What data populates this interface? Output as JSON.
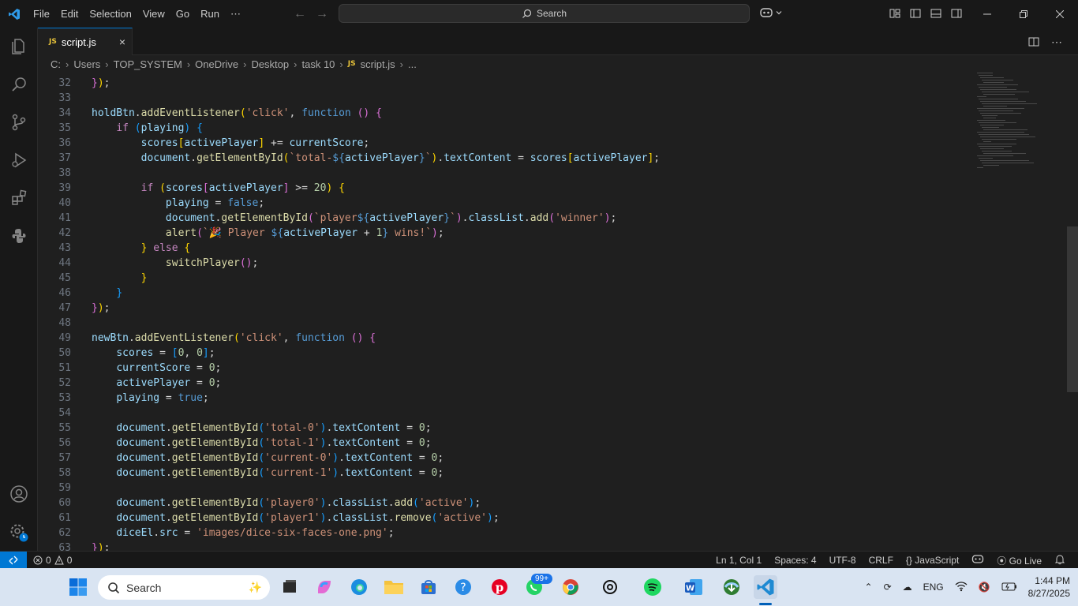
{
  "titlebar": {
    "menu": [
      "File",
      "Edit",
      "Selection",
      "View",
      "Go",
      "Run",
      "⋯"
    ],
    "search_label": "Search",
    "colors": {
      "accent": "#0078d4"
    }
  },
  "tab": {
    "label": "script.js",
    "badge": "JS",
    "close": "×"
  },
  "breadcrumb": {
    "items": [
      "C:",
      "Users",
      "TOP_SYSTEM",
      "OneDrive",
      "Desktop",
      "task 10",
      "script.js",
      "..."
    ]
  },
  "editor": {
    "lines": [
      {
        "n": "32",
        "html": "<span class=\"pb\">}</span><span class=\"p\">)</span><span class=\"t\">;</span>"
      },
      {
        "n": "33",
        "html": ""
      },
      {
        "n": "34",
        "html": "<span class=\"v\">holdBtn</span><span class=\"t\">.</span><span class=\"f\">addEventListener</span><span class=\"p\">(</span><span class=\"s\">'click'</span><span class=\"t\">, </span><span class=\"k\">function</span><span class=\"t\"> </span><span class=\"pb\">()</span><span class=\"t\"> </span><span class=\"pb\">{</span>"
      },
      {
        "n": "35",
        "html": "    <span class=\"c\">if</span><span class=\"t\"> </span><span class=\"pc\">(</span><span class=\"v\">playing</span><span class=\"pc\">)</span><span class=\"t\"> </span><span class=\"pc\">{</span>"
      },
      {
        "n": "36",
        "html": "        <span class=\"v\">scores</span><span class=\"p\">[</span><span class=\"v\">activePlayer</span><span class=\"p\">]</span><span class=\"t\"> += </span><span class=\"v\">currentScore</span><span class=\"t\">;</span>"
      },
      {
        "n": "37",
        "html": "        <span class=\"v\">document</span><span class=\"t\">.</span><span class=\"f\">getElementById</span><span class=\"p\">(</span><span class=\"s\">`total-</span><span class=\"k\">${</span><span class=\"v\">activePlayer</span><span class=\"k\">}</span><span class=\"s\">`</span><span class=\"p\">)</span><span class=\"t\">.</span><span class=\"v\">textContent</span><span class=\"t\"> = </span><span class=\"v\">scores</span><span class=\"p\">[</span><span class=\"v\">activePlayer</span><span class=\"p\">]</span><span class=\"t\">;</span>"
      },
      {
        "n": "38",
        "html": ""
      },
      {
        "n": "39",
        "html": "        <span class=\"c\">if</span><span class=\"t\"> </span><span class=\"p\">(</span><span class=\"v\">scores</span><span class=\"pb\">[</span><span class=\"v\">activePlayer</span><span class=\"pb\">]</span><span class=\"t\"> >= </span><span class=\"n\">20</span><span class=\"p\">)</span><span class=\"t\"> </span><span class=\"p\">{</span>"
      },
      {
        "n": "40",
        "html": "            <span class=\"v\">playing</span><span class=\"t\"> = </span><span class=\"k\">false</span><span class=\"t\">;</span>"
      },
      {
        "n": "41",
        "html": "            <span class=\"v\">document</span><span class=\"t\">.</span><span class=\"f\">getElementById</span><span class=\"pb\">(</span><span class=\"s\">`player</span><span class=\"k\">${</span><span class=\"v\">activePlayer</span><span class=\"k\">}</span><span class=\"s\">`</span><span class=\"pb\">)</span><span class=\"t\">.</span><span class=\"v\">classList</span><span class=\"t\">.</span><span class=\"f\">add</span><span class=\"pb\">(</span><span class=\"s\">'winner'</span><span class=\"pb\">)</span><span class=\"t\">;</span>"
      },
      {
        "n": "42",
        "html": "            <span class=\"f\">alert</span><span class=\"pb\">(</span><span class=\"s\">`🎉 Player </span><span class=\"k\">${</span><span class=\"v\">activePlayer</span><span class=\"t\"> + </span><span class=\"n\">1</span><span class=\"k\">}</span><span class=\"s\"> wins!`</span><span class=\"pb\">)</span><span class=\"t\">;</span>"
      },
      {
        "n": "43",
        "html": "        <span class=\"p\">}</span><span class=\"t\"> </span><span class=\"c\">else</span><span class=\"t\"> </span><span class=\"p\">{</span>"
      },
      {
        "n": "44",
        "html": "            <span class=\"f\">switchPlayer</span><span class=\"pb\">()</span><span class=\"t\">;</span>"
      },
      {
        "n": "45",
        "html": "        <span class=\"p\">}</span>"
      },
      {
        "n": "46",
        "html": "    <span class=\"pc\">}</span>"
      },
      {
        "n": "47",
        "html": "<span class=\"pb\">}</span><span class=\"p\">)</span><span class=\"t\">;</span>"
      },
      {
        "n": "48",
        "html": ""
      },
      {
        "n": "49",
        "html": "<span class=\"v\">newBtn</span><span class=\"t\">.</span><span class=\"f\">addEventListener</span><span class=\"p\">(</span><span class=\"s\">'click'</span><span class=\"t\">, </span><span class=\"k\">function</span><span class=\"t\"> </span><span class=\"pb\">()</span><span class=\"t\"> </span><span class=\"pb\">{</span>"
      },
      {
        "n": "50",
        "html": "    <span class=\"v\">scores</span><span class=\"t\"> = </span><span class=\"pc\">[</span><span class=\"n\">0</span><span class=\"t\">, </span><span class=\"n\">0</span><span class=\"pc\">]</span><span class=\"t\">;</span>"
      },
      {
        "n": "51",
        "html": "    <span class=\"v\">currentScore</span><span class=\"t\"> = </span><span class=\"n\">0</span><span class=\"t\">;</span>"
      },
      {
        "n": "52",
        "html": "    <span class=\"v\">activePlayer</span><span class=\"t\"> = </span><span class=\"n\">0</span><span class=\"t\">;</span>"
      },
      {
        "n": "53",
        "html": "    <span class=\"v\">playing</span><span class=\"t\"> = </span><span class=\"k\">true</span><span class=\"t\">;</span>"
      },
      {
        "n": "54",
        "html": ""
      },
      {
        "n": "55",
        "html": "    <span class=\"v\">document</span><span class=\"t\">.</span><span class=\"f\">getElementById</span><span class=\"pc\">(</span><span class=\"s\">'total-0'</span><span class=\"pc\">)</span><span class=\"t\">.</span><span class=\"v\">textContent</span><span class=\"t\"> = </span><span class=\"n\">0</span><span class=\"t\">;</span>"
      },
      {
        "n": "56",
        "html": "    <span class=\"v\">document</span><span class=\"t\">.</span><span class=\"f\">getElementById</span><span class=\"pc\">(</span><span class=\"s\">'total-1'</span><span class=\"pc\">)</span><span class=\"t\">.</span><span class=\"v\">textContent</span><span class=\"t\"> = </span><span class=\"n\">0</span><span class=\"t\">;</span>"
      },
      {
        "n": "57",
        "html": "    <span class=\"v\">document</span><span class=\"t\">.</span><span class=\"f\">getElementById</span><span class=\"pc\">(</span><span class=\"s\">'current-0'</span><span class=\"pc\">)</span><span class=\"t\">.</span><span class=\"v\">textContent</span><span class=\"t\"> = </span><span class=\"n\">0</span><span class=\"t\">;</span>"
      },
      {
        "n": "58",
        "html": "    <span class=\"v\">document</span><span class=\"t\">.</span><span class=\"f\">getElementById</span><span class=\"pc\">(</span><span class=\"s\">'current-1'</span><span class=\"pc\">)</span><span class=\"t\">.</span><span class=\"v\">textContent</span><span class=\"t\"> = </span><span class=\"n\">0</span><span class=\"t\">;</span>"
      },
      {
        "n": "59",
        "html": ""
      },
      {
        "n": "60",
        "html": "    <span class=\"v\">document</span><span class=\"t\">.</span><span class=\"f\">getElementById</span><span class=\"pc\">(</span><span class=\"s\">'player0'</span><span class=\"pc\">)</span><span class=\"t\">.</span><span class=\"v\">classList</span><span class=\"t\">.</span><span class=\"f\">add</span><span class=\"pc\">(</span><span class=\"s\">'active'</span><span class=\"pc\">)</span><span class=\"t\">;</span>"
      },
      {
        "n": "61",
        "html": "    <span class=\"v\">document</span><span class=\"t\">.</span><span class=\"f\">getElementById</span><span class=\"pc\">(</span><span class=\"s\">'player1'</span><span class=\"pc\">)</span><span class=\"t\">.</span><span class=\"v\">classList</span><span class=\"t\">.</span><span class=\"f\">remove</span><span class=\"pc\">(</span><span class=\"s\">'active'</span><span class=\"pc\">)</span><span class=\"t\">;</span>"
      },
      {
        "n": "62",
        "html": "    <span class=\"v\">diceEl</span><span class=\"t\">.</span><span class=\"v\">src</span><span class=\"t\"> = </span><span class=\"s\">'images/dice-six-faces-one.png'</span><span class=\"t\">;</span>"
      },
      {
        "n": "63",
        "html": "<span class=\"pb\">}</span><span class=\"p\">)</span><span class=\"t\">;</span>"
      }
    ]
  },
  "statusbar": {
    "errors": "0",
    "warnings": "0",
    "position": "Ln 1, Col 1",
    "spaces": "Spaces: 4",
    "encoding": "UTF-8",
    "eol": "CRLF",
    "language": "JavaScript",
    "golive": "Go Live"
  },
  "taskbar": {
    "search_label": "Search",
    "notification_badge": "99+",
    "language": "ENG",
    "time": "1:44 PM",
    "date": "8/27/2025"
  }
}
